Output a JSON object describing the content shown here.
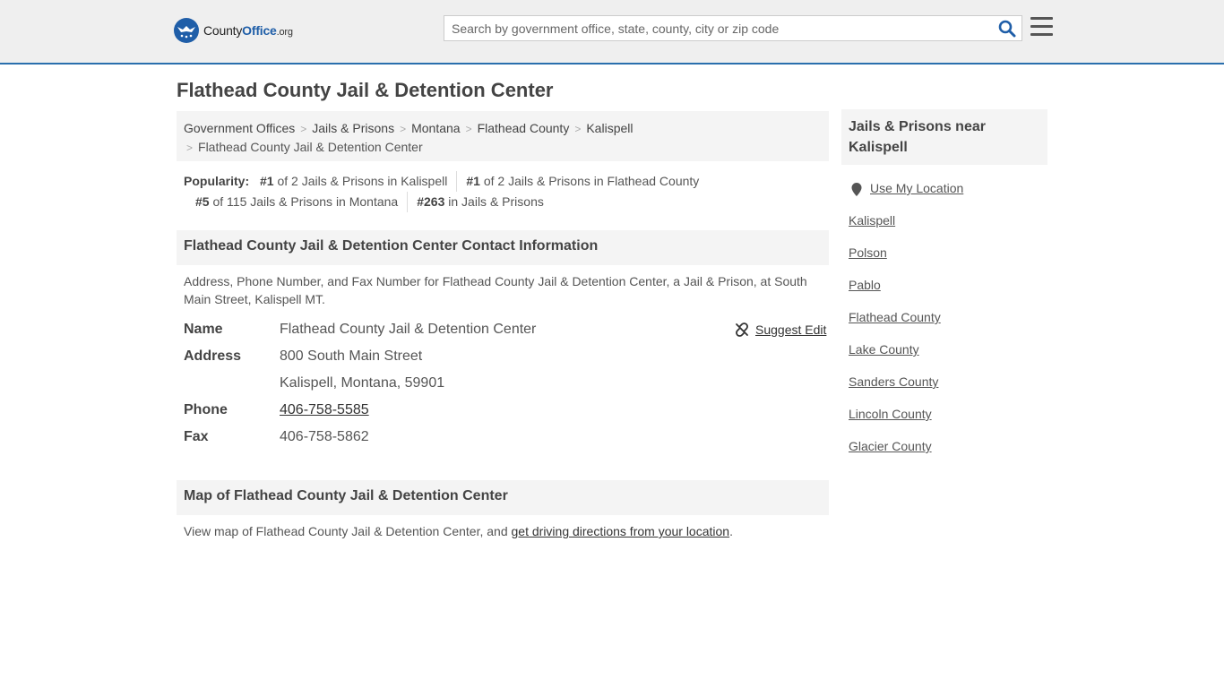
{
  "header": {
    "logo": {
      "county": "County",
      "office": "Office",
      "org": ".org"
    },
    "search": {
      "placeholder": "Search by government office, state, county, city or zip code"
    }
  },
  "page_title": "Flathead County Jail & Detention Center",
  "breadcrumb": [
    "Government Offices",
    "Jails & Prisons",
    "Montana",
    "Flathead County",
    "Kalispell",
    "Flathead County Jail & Detention Center"
  ],
  "popularity": {
    "label": "Popularity:",
    "items": [
      {
        "rank": "#1",
        "text": "of 2 Jails & Prisons in Kalispell"
      },
      {
        "rank": "#1",
        "text": "of 2 Jails & Prisons in Flathead County"
      },
      {
        "rank": "#5",
        "text": "of 115 Jails & Prisons in Montana"
      },
      {
        "rank": "#263",
        "text": "in Jails & Prisons"
      }
    ]
  },
  "contact": {
    "heading": "Flathead County Jail & Detention Center Contact Information",
    "description": "Address, Phone Number, and Fax Number for Flathead County Jail & Detention Center, a Jail & Prison, at South Main Street, Kalispell MT.",
    "suggest_edit": "Suggest Edit",
    "name_label": "Name",
    "name": "Flathead County Jail & Detention Center",
    "address_label": "Address",
    "address_line1": "800 South Main Street",
    "address_line2": "Kalispell, Montana, 59901",
    "phone_label": "Phone",
    "phone": "406-758-5585",
    "fax_label": "Fax",
    "fax": "406-758-5862"
  },
  "map": {
    "heading": "Map of Flathead County Jail & Detention Center",
    "text": "View map of Flathead County Jail & Detention Center, and ",
    "link": "get driving directions from your location",
    "end": "."
  },
  "sidebar": {
    "heading": "Jails & Prisons near Kalispell",
    "use_location": "Use My Location",
    "links": [
      "Kalispell",
      "Polson",
      "Pablo",
      "Flathead County",
      "Lake County",
      "Sanders County",
      "Lincoln County",
      "Glacier County"
    ]
  },
  "colors": {
    "brand_blue": "#1f5ea8",
    "header_bg": "#efefef",
    "panel_bg": "#f4f4f4"
  }
}
